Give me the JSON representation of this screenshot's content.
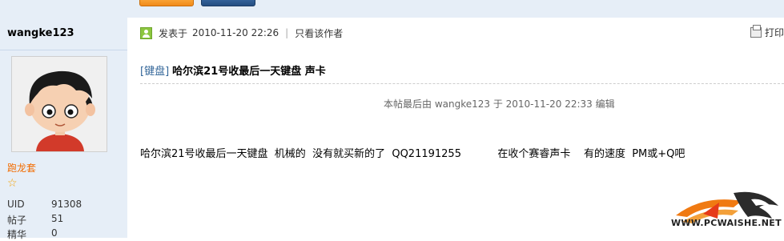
{
  "user": {
    "name": "wangke123",
    "group": "跑龙套",
    "stats": [
      {
        "label": "UID",
        "value": "91308"
      },
      {
        "label": "帖子",
        "value": "51"
      },
      {
        "label": "精华",
        "value": "0"
      }
    ]
  },
  "post": {
    "meta_prefix": "发表于",
    "datetime": "2010-11-20 22:26",
    "only_author": "只看该作者",
    "print_label": "打印",
    "category": "[键盘]",
    "title": "哈尔滨21号收最后一天键盘  声卡",
    "edited_note": "本帖最后由  wangke123 于  2010-11-20 22:33 编辑",
    "body": "哈尔滨21号收最后一天键盘  机械的  没有就买新的了  QQ21191255           在收个赛睿声卡    有的速度  PM或+Q吧"
  },
  "watermark": {
    "text": "WWW.PCWAISHE.NET"
  },
  "colors": {
    "sidebar_bg": "#e6eef7",
    "group_color": "#f26c00",
    "category_color": "#336699"
  },
  "icons": [
    "user-post-icon",
    "printer-icon",
    "star-icon"
  ]
}
